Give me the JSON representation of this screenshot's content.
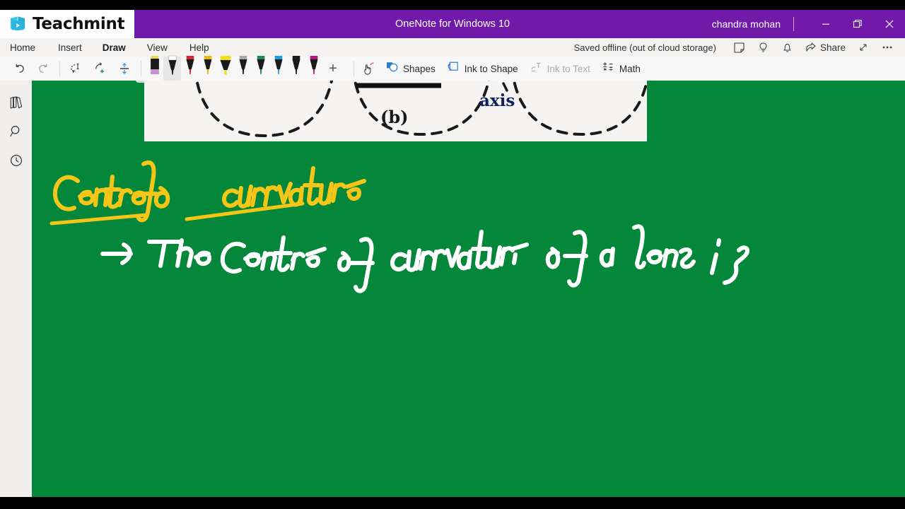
{
  "window": {
    "brand": "Teachmint",
    "brand_icon": "book-play-icon",
    "title": "OneNote for Windows 10",
    "account_name": "chandra mohan",
    "controls": {
      "minimize": "minimize-button",
      "restore": "restore-button",
      "close": "close-button"
    },
    "accent_purple": "#7119A8",
    "canvas_green": "#04873A"
  },
  "menu": {
    "items": [
      {
        "label": "Home",
        "active": false
      },
      {
        "label": "Insert",
        "active": false
      },
      {
        "label": "Draw",
        "active": true
      },
      {
        "label": "View",
        "active": false
      },
      {
        "label": "Help",
        "active": false
      }
    ]
  },
  "status": {
    "saved_text": "Saved offline (out of cloud storage)",
    "icons": [
      "sticky-note-icon",
      "lightbulb-icon",
      "bell-icon"
    ],
    "share_label": "Share",
    "expand_icon": "expand-arrow-icon",
    "more_icon": "ellipsis-icon"
  },
  "toolbar": {
    "undo": "undo-icon",
    "redo": "redo-icon",
    "lasso_select": "lasso-select-icon",
    "eraser_tool": "eraser-add-icon",
    "pens": [
      {
        "name": "eraser",
        "color": "#c78fd6",
        "cap": "#e9d84f",
        "selected": false,
        "type": "eraser"
      },
      {
        "name": "pen-black",
        "color": "#111111",
        "cap": "#ffffff",
        "selected": true,
        "type": "pen"
      },
      {
        "name": "pen-red",
        "color": "#d42838",
        "cap": "#d42838",
        "selected": false,
        "type": "pen"
      },
      {
        "name": "pen-yellow",
        "color": "#e8b714",
        "cap": "#e8b714",
        "selected": false,
        "type": "pen"
      },
      {
        "name": "highlighter-yellow",
        "color": "#f2e017",
        "cap": "#f2e017",
        "selected": false,
        "type": "highlighter"
      },
      {
        "name": "pen-silver",
        "color": "#a9a9a9",
        "cap": "#a9a9a9",
        "selected": false,
        "type": "pen"
      },
      {
        "name": "pen-green",
        "color": "#1b8a54",
        "cap": "#1b8a54",
        "selected": false,
        "type": "pen"
      },
      {
        "name": "pen-cyan",
        "color": "#1b9ed6",
        "cap": "#1b9ed6",
        "selected": false,
        "type": "pen"
      },
      {
        "name": "pen-black-2",
        "color": "#111111",
        "cap": "#111111",
        "selected": false,
        "type": "pen"
      },
      {
        "name": "pen-magenta",
        "color": "#b5157f",
        "cap": "#b5157f",
        "selected": false,
        "type": "pen"
      }
    ],
    "add_pen_label": "+",
    "touch_draw_icon": "touch-draw-icon",
    "shapes_label": "Shapes",
    "ink_to_shape_label": "Ink to Shape",
    "ink_to_text_label": "Ink to Text",
    "ink_to_text_disabled": true,
    "math_label": "Math"
  },
  "rail": {
    "items": [
      {
        "icon": "notebooks-icon",
        "name": "notebooks"
      },
      {
        "icon": "search-icon",
        "name": "search"
      },
      {
        "icon": "recent-clock-icon",
        "name": "recent-notes"
      }
    ]
  },
  "page": {
    "clipped_image": {
      "alt": "lens curvature diagram",
      "figure_label": "(b)",
      "axis_label": "axis"
    },
    "ink_notes": [
      {
        "id": "heading",
        "text": "Centre of curvature",
        "color": "#f5c518",
        "underlined": true
      },
      {
        "id": "body-line-1",
        "text": "→) The Centre of curvature of a lens is",
        "color": "#ffffff",
        "underlined": false
      }
    ]
  }
}
